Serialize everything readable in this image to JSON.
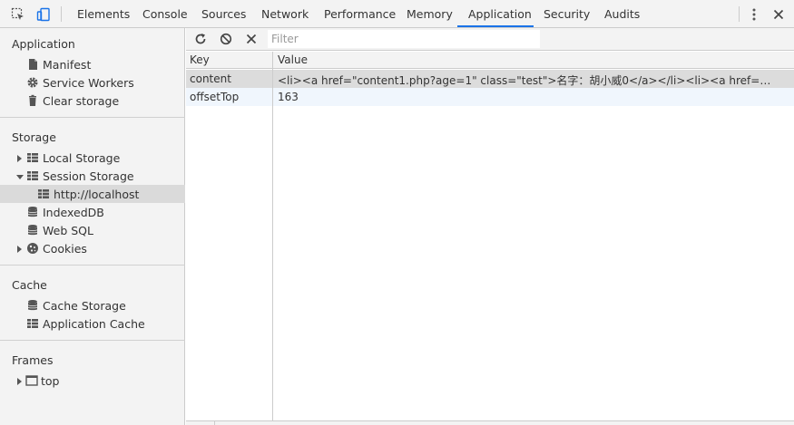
{
  "tabs": [
    "Elements",
    "Console",
    "Sources",
    "Network",
    "Performance",
    "Memory",
    "Application",
    "Security",
    "Audits"
  ],
  "active_tab": "Application",
  "accent_color": "#1a73e8",
  "sidebar": {
    "application": {
      "title": "Application",
      "items": [
        "Manifest",
        "Service Workers",
        "Clear storage"
      ]
    },
    "storage": {
      "title": "Storage",
      "items": [
        "Local Storage",
        "Session Storage",
        "http://localhost",
        "IndexedDB",
        "Web SQL",
        "Cookies"
      ]
    },
    "cache": {
      "title": "Cache",
      "items": [
        "Cache Storage",
        "Application Cache"
      ]
    },
    "frames": {
      "title": "Frames",
      "items": [
        "top"
      ]
    }
  },
  "toolbar": {
    "filter_placeholder": "Filter"
  },
  "table": {
    "headers": [
      "Key",
      "Value"
    ],
    "rows": [
      {
        "key": "content",
        "value": "<li><a href=\"content1.php?age=1\" class=\"test\">名字：胡小威0</a></li><li><a href=\"content1.php..."
      },
      {
        "key": "offsetTop",
        "value": "163"
      }
    ]
  }
}
